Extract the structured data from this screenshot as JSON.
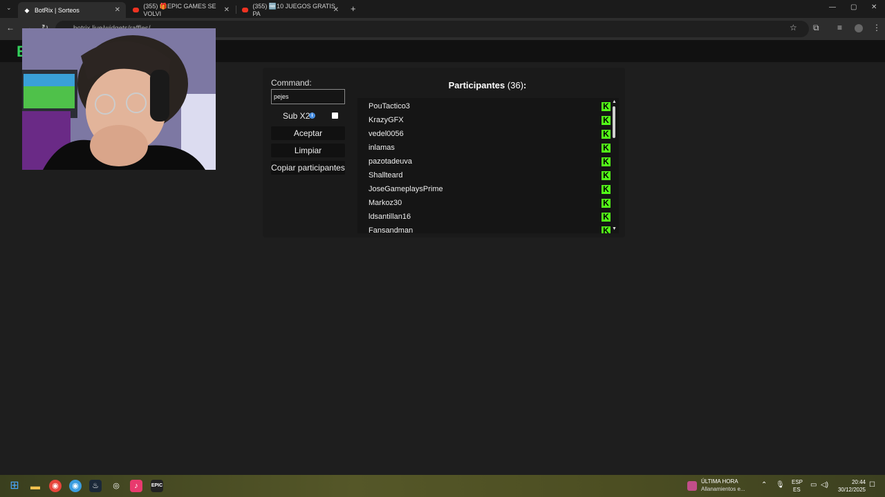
{
  "browser": {
    "tabs": [
      {
        "title": "BotRix | Sorteos",
        "favicon": "botrix-icon",
        "active": true
      },
      {
        "title": "(355) 🎁EPIC GAMES SE VOLVI",
        "favicon": "youtube-icon",
        "active": false
      },
      {
        "title": "(355) 🆓10 JUEGOS GRATIS PA",
        "favicon": "youtube-icon",
        "active": false
      }
    ],
    "new_tab": "+",
    "address": "botrix.live/widgets/raffles/"
  },
  "site": {
    "logo": "B"
  },
  "raffle": {
    "command_label": "Command:",
    "command_value": "pejes",
    "sub_label": "Sub X2",
    "info_glyph": "i",
    "sub_checked": false,
    "accept_label": "Aceptar",
    "clear_label": "Limpiar",
    "copy_label": "Copiar participantes",
    "participants_title": "Participantes",
    "participants_count": "(36)",
    "participants_colon": ":",
    "kick_glyph": "K",
    "participants": [
      "PouTactico3",
      "KrazyGFX",
      "vedel0056",
      "inlamas",
      "pazotadeuva",
      "Shallteard",
      "JoseGameplaysPrime",
      "Markoz30",
      "ldsantillan16",
      "Fansandman"
    ]
  },
  "taskbar": {
    "news_title": "ÚLTIMA HORA",
    "news_sub": "Allanamientos e...",
    "lang_top": "ESP",
    "lang_bottom": "ES",
    "time": "20:44",
    "date": "30/12/2025"
  },
  "colors": {
    "accent": "#33d15c",
    "kick_green": "#53fc18",
    "info_blue": "#4a8fe0"
  }
}
